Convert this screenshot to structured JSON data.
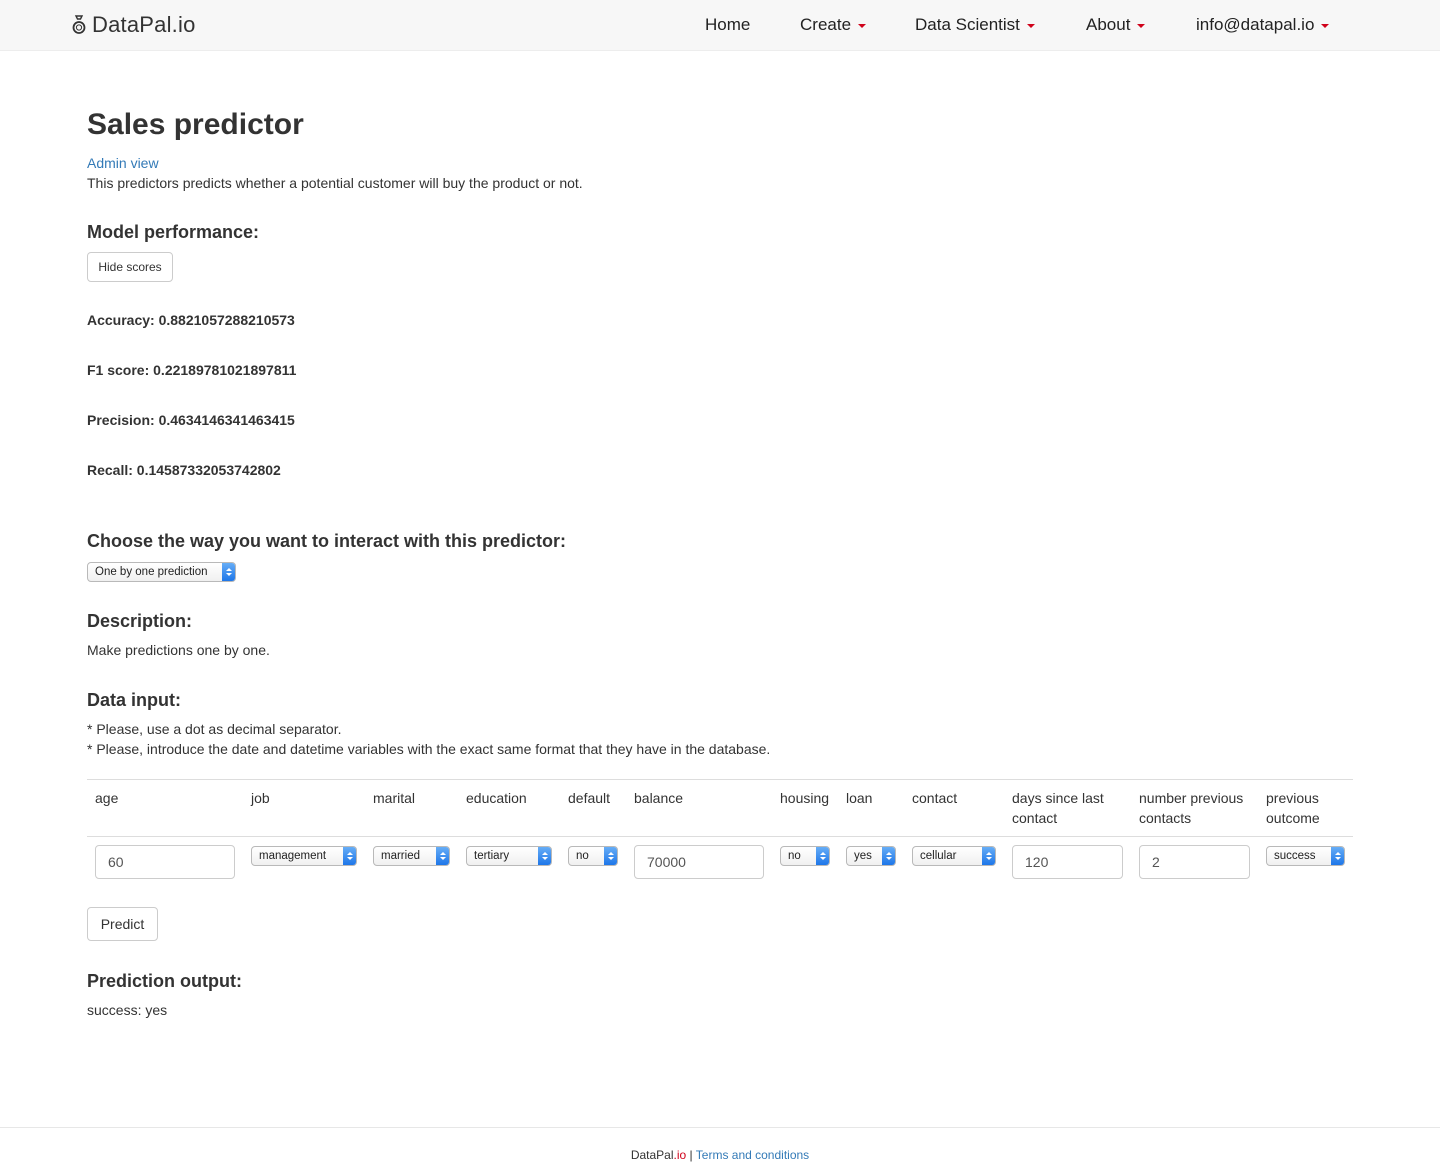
{
  "navbar": {
    "brand": "DataPal.io",
    "items": [
      "Home",
      "Create",
      "Data Scientist",
      "About",
      "info@datapal.io"
    ]
  },
  "page": {
    "title": "Sales predictor",
    "admin_link": "Admin view",
    "subtitle": "This predictors predicts whether a potential customer will buy the product or not."
  },
  "performance": {
    "heading": "Model performance:",
    "toggle_label": "Hide scores",
    "accuracy": "Accuracy: 0.8821057288210573",
    "f1": "F1 score: 0.22189781021897811",
    "precision": "Precision: 0.4634146341463415",
    "recall": "Recall: 0.14587332053742802"
  },
  "interaction": {
    "heading": "Choose the way you want to interact with this predictor:",
    "mode_selected": "One by one prediction"
  },
  "description": {
    "heading": "Description:",
    "text": "Make predictions one by one."
  },
  "data_input": {
    "heading": "Data input:",
    "note1": "* Please, use a dot as decimal separator.",
    "note2": "* Please, introduce the date and datetime variables with the exact same format that they have in the database.",
    "columns": {
      "age": "age",
      "job": "job",
      "marital": "marital",
      "education": "education",
      "default": "default",
      "balance": "balance",
      "housing": "housing",
      "loan": "loan",
      "contact": "contact",
      "days_line1": "days since last",
      "days_line2": "contact",
      "prev_contacts_line1": "number previous",
      "prev_contacts_line2": "contacts",
      "prev_outcome_line1": "previous",
      "prev_outcome_line2": "outcome"
    },
    "values": {
      "age": "60",
      "job": "management",
      "marital": "married",
      "education": "tertiary",
      "default": "no",
      "balance": "70000",
      "housing": "no",
      "loan": "yes",
      "contact": "cellular",
      "days": "120",
      "prev_contacts": "2",
      "prev_outcome": "success"
    },
    "predict_label": "Predict"
  },
  "output": {
    "heading": "Prediction output:",
    "result": "success: yes"
  },
  "footer": {
    "brand_prefix": "DataPal",
    "brand_suffix": ".io",
    "separator": " | ",
    "terms": "Terms and conditions"
  },
  "colors": {
    "accent_red": "#d0021b",
    "link_blue": "#337ab7",
    "select_blue": "#1a73e8"
  }
}
